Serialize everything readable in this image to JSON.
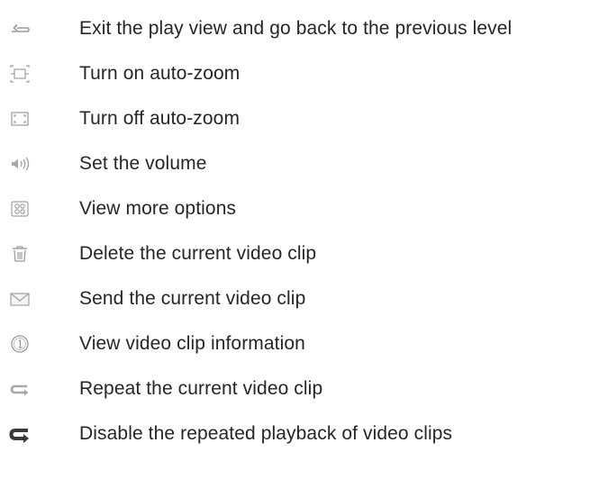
{
  "items": [
    {
      "icon": "back-arrow-icon",
      "label": "Exit the play view and go back to the previous level"
    },
    {
      "icon": "auto-zoom-on-icon",
      "label": "Turn on auto-zoom"
    },
    {
      "icon": "auto-zoom-off-icon",
      "label": "Turn off auto-zoom"
    },
    {
      "icon": "volume-icon",
      "label": "Set the volume"
    },
    {
      "icon": "options-grid-icon",
      "label": "View more options"
    },
    {
      "icon": "trash-icon",
      "label": "Delete the current video clip"
    },
    {
      "icon": "envelope-icon",
      "label": "Send the current video clip"
    },
    {
      "icon": "info-icon",
      "label": "View video clip information"
    },
    {
      "icon": "repeat-icon",
      "label": "Repeat the current video clip"
    },
    {
      "icon": "repeat-off-icon",
      "label": "Disable the repeated playback of video clips"
    }
  ]
}
